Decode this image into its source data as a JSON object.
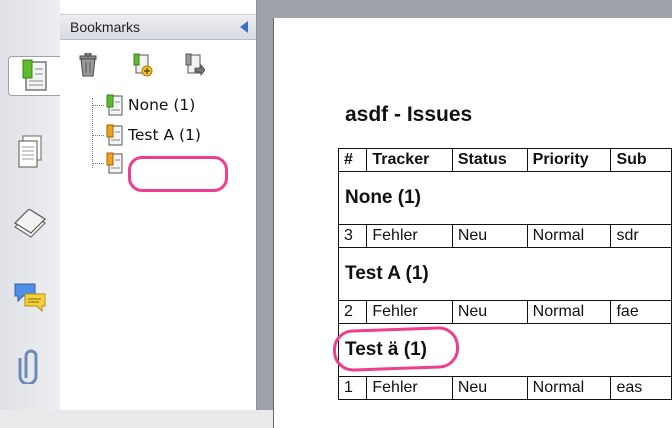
{
  "panel": {
    "title": "Bookmarks",
    "toolbar": {
      "delete_icon": "trash-icon",
      "new_bookmark_icon": "new-bookmark-icon",
      "bookmark_options_icon": "bookmark-arrow-icon"
    },
    "bookmarks": [
      {
        "label": "None (1)"
      },
      {
        "label": "Test A (1)"
      },
      {
        "label": ""
      }
    ]
  },
  "sidebar_tools": [
    "bookmarks-icon",
    "pages-icon",
    "layers-icon",
    "comments-icon",
    "attachments-icon"
  ],
  "document": {
    "title": "asdf - Issues",
    "columns": [
      "#",
      "Tracker",
      "Status",
      "Priority",
      "Sub"
    ],
    "groups": [
      {
        "name": "None (1)",
        "rows": [
          [
            "3",
            "Fehler",
            "Neu",
            "Normal",
            "sdr"
          ]
        ]
      },
      {
        "name": "Test A (1)",
        "rows": [
          [
            "2",
            "Fehler",
            "Neu",
            "Normal",
            "fae"
          ]
        ]
      },
      {
        "name": "Test ä (1)",
        "rows": [
          [
            "1",
            "Fehler",
            "Neu",
            "Normal",
            "eas"
          ]
        ]
      }
    ]
  },
  "colors": {
    "highlight": "#ee3e8d",
    "accent": "#3d6fc4"
  }
}
